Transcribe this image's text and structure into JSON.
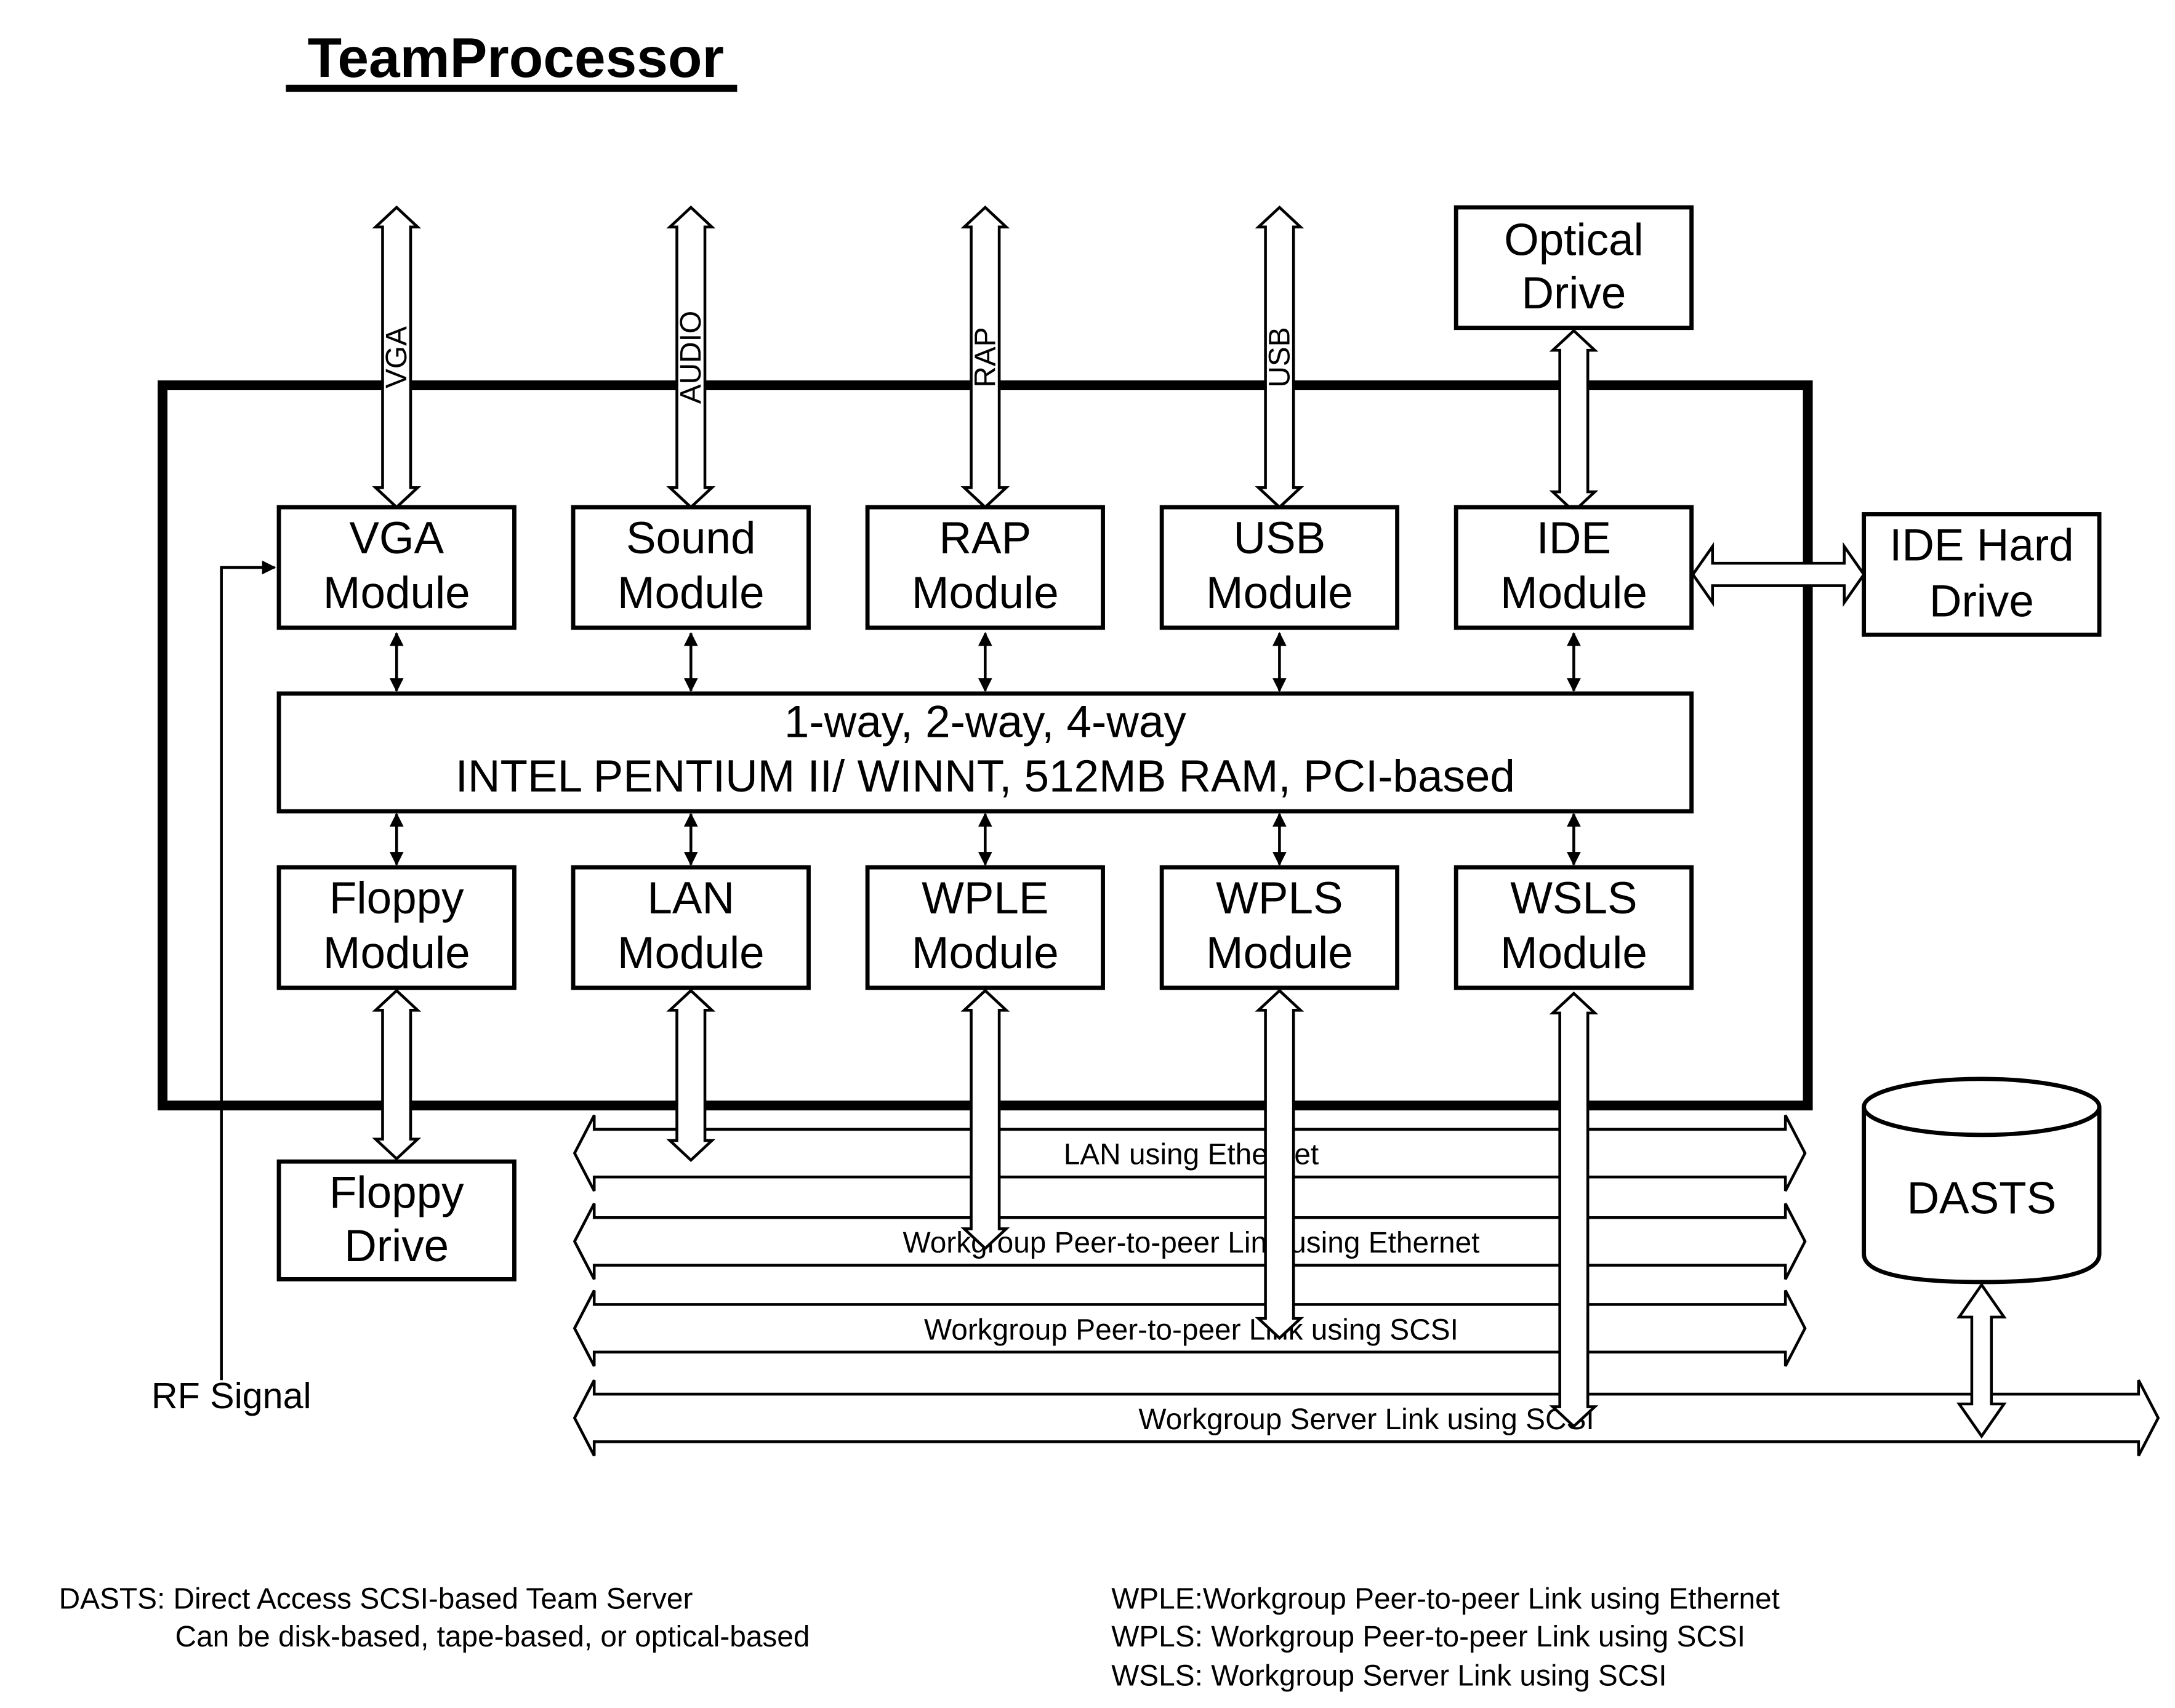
{
  "title": "TeamProcessor",
  "colors": {
    "ink": "#000000",
    "background": "#ffffff"
  },
  "top_buses": [
    {
      "label": "VGA"
    },
    {
      "label": "AUDIO"
    },
    {
      "label": "RAP"
    },
    {
      "label": "USB"
    }
  ],
  "top_modules": [
    {
      "line1": "VGA",
      "line2": "Module"
    },
    {
      "line1": "Sound",
      "line2": "Module"
    },
    {
      "line1": "RAP",
      "line2": "Module"
    },
    {
      "line1": "USB",
      "line2": "Module"
    },
    {
      "line1": "IDE",
      "line2": "Module"
    }
  ],
  "cpu": {
    "line1": "1-way, 2-way, 4-way",
    "line2": "INTEL PENTIUM II/ WINNT, 512MB RAM, PCI-based"
  },
  "bottom_modules": [
    {
      "line1": "Floppy",
      "line2": "Module"
    },
    {
      "line1": "LAN",
      "line2": "Module"
    },
    {
      "line1": "WPLE",
      "line2": "Module"
    },
    {
      "line1": "WPLS",
      "line2": "Module"
    },
    {
      "line1": "WSLS",
      "line2": "Module"
    }
  ],
  "external": {
    "optical_drive": {
      "line1": "Optical",
      "line2": "Drive"
    },
    "ide_hard_drive": {
      "line1": "IDE Hard",
      "line2": "Drive"
    },
    "floppy_drive": {
      "line1": "Floppy",
      "line2": "Drive"
    },
    "dasts": "DASTS",
    "rf_signal": "RF Signal"
  },
  "networks": [
    {
      "label": "LAN using Ethernet"
    },
    {
      "label": "Workgroup Peer-to-peer Link using Ethernet"
    },
    {
      "label": "Workgroup Peer-to-peer Link using SCSI"
    },
    {
      "label": "Workgroup Server Link using SCSI"
    }
  ],
  "legend_left": [
    "DASTS: Direct Access SCSI-based Team Server",
    "Can be disk-based, tape-based, or optical-based"
  ],
  "legend_right": [
    "WPLE:Workgroup Peer-to-peer Link using Ethernet",
    "WPLS: Workgroup Peer-to-peer Link using SCSI",
    "WSLS: Workgroup Server Link using SCSI"
  ]
}
